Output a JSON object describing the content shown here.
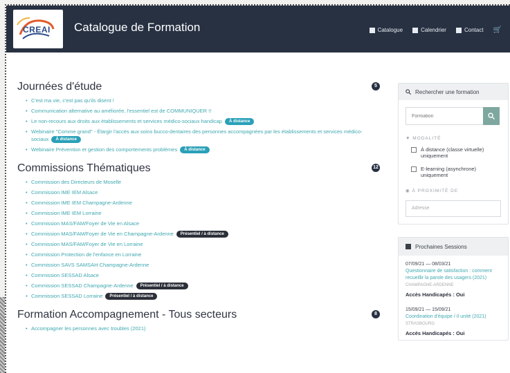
{
  "header": {
    "logo_text": "CREAI",
    "title": "Catalogue de Formation",
    "nav": [
      {
        "label": "Catalogue",
        "icon": "book-icon"
      },
      {
        "label": "Calendrier",
        "icon": "calendar-icon"
      },
      {
        "label": "Contact",
        "icon": "envelope-icon"
      }
    ],
    "cart_icon": "cart-icon"
  },
  "sections": [
    {
      "title": "Journées d'étude",
      "count": "5",
      "items": [
        {
          "text": "C'est ma vie, c'est pas qu'ils disent !",
          "tag": ""
        },
        {
          "text": "Communication alternative au améliorée, l'essentiel est de COMMUNIQUER !!",
          "tag": ""
        },
        {
          "text": "Le non-recours aux droits aux établissements et services médico-sociaux handicap",
          "tag": "À distance"
        },
        {
          "text": "Webinaire \"Comme grand\" - Élargir l'accès aux soins bucco-dentaires des personnes accompagnées par les établissements et services médico-sociaux",
          "tag": "À distance"
        },
        {
          "text": "Webinaire Prévention et gestion des comportements problèmes",
          "tag": "À distance"
        }
      ]
    },
    {
      "title": "Commissions Thématiques",
      "count": "12",
      "items": [
        {
          "text": "Commission des Directeurs de Moselle",
          "tag": ""
        },
        {
          "text": "Commission IME IEM Alsace",
          "tag": ""
        },
        {
          "text": "Commission IME IEM Champagne-Ardenne",
          "tag": ""
        },
        {
          "text": "Commission IME IEM Lorraine",
          "tag": ""
        },
        {
          "text": "Commission MAS/FAM/Foyer de Vie en Alsace",
          "tag": ""
        },
        {
          "text": "Commission MAS/FAM/Foyer de Vie en Champagne-Ardenne",
          "tag": "Présentiel / à distance"
        },
        {
          "text": "Commission MAS/FAM/Foyer de Vie en Lorraine",
          "tag": ""
        },
        {
          "text": "Commission Protection de l'enfance en Lorraine",
          "tag": ""
        },
        {
          "text": "Commission SAVS SAMSAH Champagne-Ardenne",
          "tag": ""
        },
        {
          "text": "Commission SESSAD Alsace",
          "tag": ""
        },
        {
          "text": "Commission SESSAD Champagne-Ardenne",
          "tag": "Présentiel / à distance"
        },
        {
          "text": "Commission SESSAD Lorraine",
          "tag": "Présentiel / à distance"
        }
      ]
    },
    {
      "title": "Formation Accompagnement - Tous secteurs",
      "count": "8",
      "items": [
        {
          "text": "Accompagner les personnes avec troubles (2021)",
          "tag": ""
        }
      ]
    }
  ],
  "sidebar": {
    "search": {
      "heading": "Rechercher une formation",
      "placeholder": "Formation"
    },
    "modalite": {
      "label": "Modalité",
      "options": [
        "À distance (classe virtuelle) uniquement",
        "E-learning (asynchrone) uniquement"
      ]
    },
    "proximite": {
      "label": "À proximité de",
      "placeholder": "Adresse"
    },
    "sessions": {
      "heading": "Prochaines Sessions",
      "items": [
        {
          "dates": "07/09/21 — 08/03/21",
          "title": "Questionnaire de satisfaction : comment recueillir la parole des usagers (2021)",
          "place": "CHAMPAGNE-ARDENNE",
          "access": "Accès Handicapés : Oui"
        },
        {
          "dates": "15/09/21 — 15/09/21",
          "title": "Coordination d'équipe / Il unité (2021)",
          "place": "STRASBOURG",
          "access": "Accès Handicapés : Oui"
        }
      ]
    }
  }
}
